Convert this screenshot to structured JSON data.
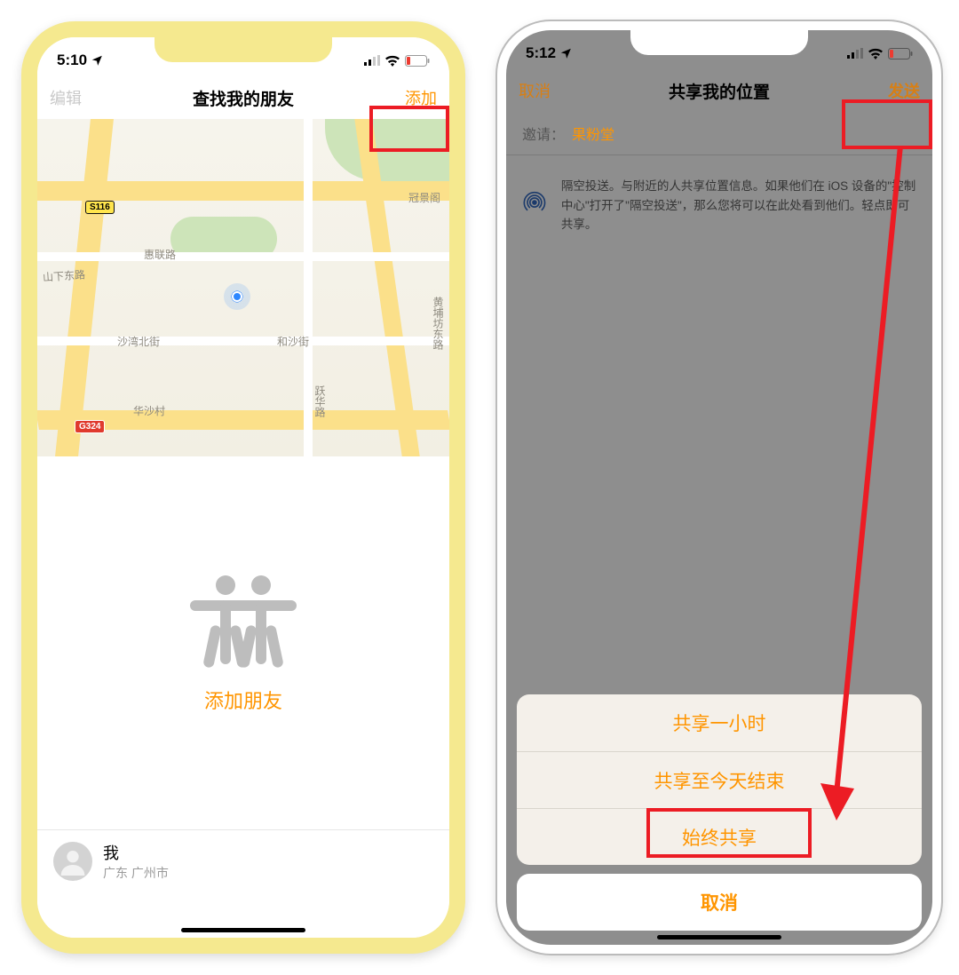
{
  "status": {
    "time_left": "5:10",
    "time_right": "5:12"
  },
  "left": {
    "nav_edit": "编辑",
    "nav_title": "查找我的朋友",
    "nav_add": "添加",
    "map": {
      "shield_s": "S116",
      "shield_g": "G324",
      "labels": {
        "guanjing": "冠景阁",
        "huilian": "惠联路",
        "shanxia": "山下东路",
        "shawan": "沙湾北街",
        "hesha": "和沙街",
        "huasha": "华沙村",
        "yuehua": "跃华路",
        "huangbei": "黄埔坊东路"
      }
    },
    "add_friends": "添加朋友",
    "me_name": "我",
    "me_sub": "广东 广州市"
  },
  "right": {
    "nav_cancel": "取消",
    "nav_title": "共享我的位置",
    "nav_send": "发送",
    "invite_label": "邀请：",
    "invite_name": "果粉堂",
    "airdrop_text": "隔空投送。与附近的人共享位置信息。如果他们在 iOS 设备的\"控制中心\"打开了\"隔空投送\"，那么您将可以在此处看到他们。轻点即可共享。",
    "opt_hour": "共享一小时",
    "opt_today": "共享至今天结束",
    "opt_forever": "始终共享",
    "cancel": "取消"
  }
}
